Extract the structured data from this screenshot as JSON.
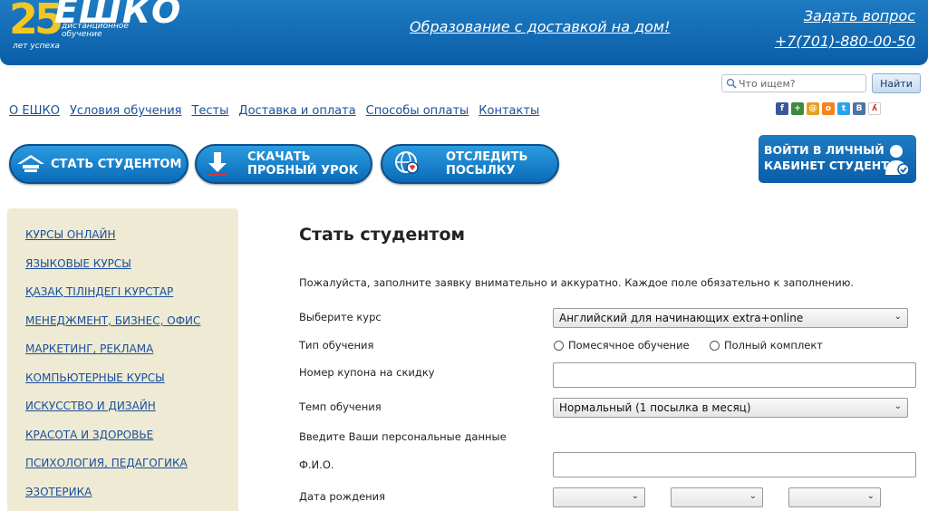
{
  "header": {
    "logo_number": "25",
    "logo_name": "ЕШКО",
    "logo_sub_1": "дистанционное",
    "logo_sub_2": "обучение",
    "logo_years": "лет успеха",
    "slogan": "Образование с доставкой на дом!",
    "ask_link": "Задать вопрос",
    "phone": "+7(701)-880-00-50"
  },
  "search": {
    "placeholder": "Что ищем?",
    "button": "Найти"
  },
  "nav": [
    "О ЕШКО",
    "Условия обучения",
    "Тесты",
    "Доставка и оплата",
    "Способы оплаты",
    "Контакты"
  ],
  "social_icons": [
    "facebook-icon",
    "plus-icon",
    "mail-icon",
    "odnoklassniki-icon",
    "twitter-icon",
    "vk-icon",
    "run-icon"
  ],
  "actions": {
    "become_student": "СТАТЬ СТУДЕНТОМ",
    "download_line1": "СКАЧАТЬ",
    "download_line2": "ПРОБНЫЙ УРОК",
    "track_line1": "ОТСЛЕДИТЬ",
    "track_line2": "ПОСЫЛКУ",
    "cabinet_line1": "ВОЙТИ В ЛИЧНЫЙ",
    "cabinet_line2": "КАБИНЕТ СТУДЕНТА"
  },
  "sidebar": [
    "КУРСЫ ОНЛАЙН",
    "ЯЗЫКОВЫЕ КУРСЫ",
    "ҚАЗАҚ ТІЛІНДЕГІ КУРСТАР",
    "МЕНЕДЖМЕНТ, БИЗНЕС, ОФИС",
    "МАРКЕТИНГ, РЕКЛАМА",
    "КОМПЬЮТЕРНЫЕ КУРСЫ",
    "ИСКУССТВО И ДИЗАЙН",
    "КРАСОТА И ЗДОРОВЬЕ",
    "ПСИХОЛОГИЯ, ПЕДАГОГИКА",
    "ЭЗОТЕРИКА"
  ],
  "form": {
    "title": "Стать студентом",
    "intro": "Пожалуйста, заполните заявку внимательно и аккуратно. Каждое поле обязательно к заполнению.",
    "course_label": "Выберите курс",
    "course_value": "Английский для начинающих extra+online",
    "type_label": "Тип обучения",
    "type_option_1": "Помесячное обучение",
    "type_option_2": "Полный комплект",
    "coupon_label": "Номер купона на скидку",
    "pace_label": "Темп обучения",
    "pace_value": "Нормальный (1 посылка в месяц)",
    "personal_label": "Введите Ваши персональные данные",
    "name_label": "Ф.И.О.",
    "birth_label": "Дата рождения"
  },
  "colors": {
    "brand_blue": "#0b5ea8",
    "link": "#1a4f9c",
    "logo_gold": "#f3c623",
    "sidebar_bg": "#eeead4"
  }
}
